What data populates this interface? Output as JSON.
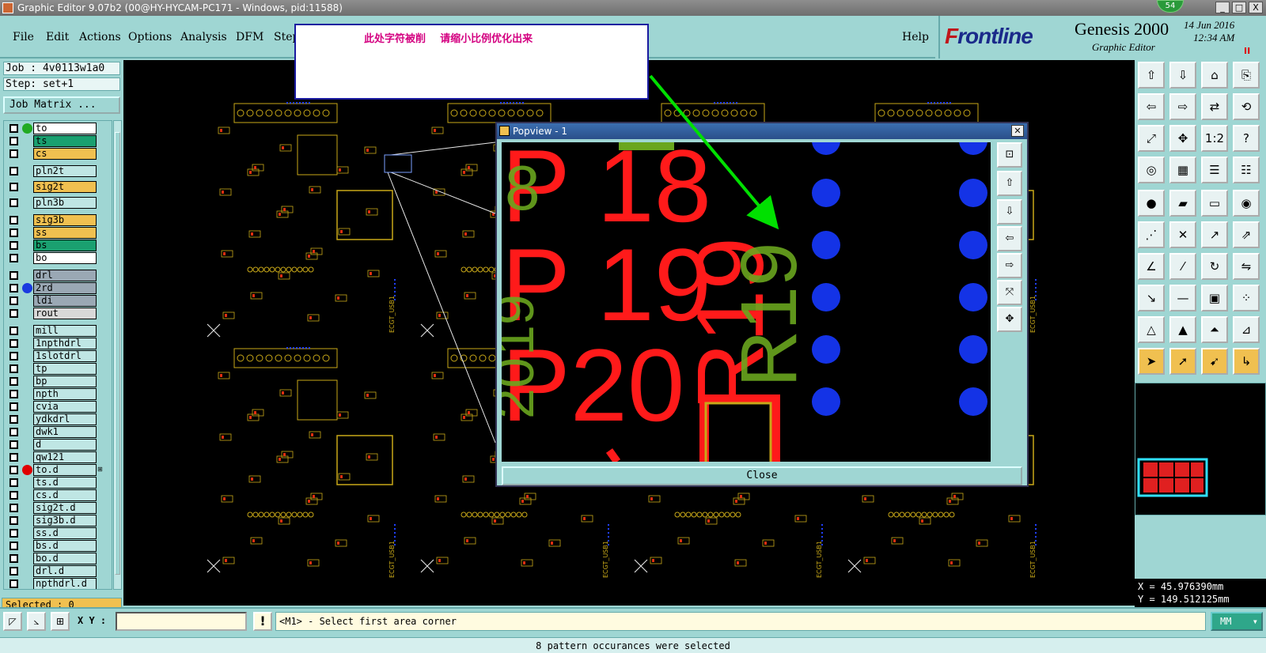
{
  "window": {
    "title": "Graphic Editor 9.07b2 (00@HY-HYCAM-PC171 - Windows, pid:11588)",
    "badge": "54",
    "minimize": "_",
    "maximize": "□",
    "close": "X"
  },
  "menu": {
    "items": [
      "File",
      "Edit",
      "Actions",
      "Options",
      "Analysis",
      "DFM",
      "Step"
    ],
    "help": "Help"
  },
  "brand": {
    "logo_f": "F",
    "logo_rest": "rontline",
    "product": "Genesis 2000",
    "subtitle": "Graphic Editor",
    "date": "14 Jun 2016",
    "time": "12:34 AM",
    "flag": "II"
  },
  "annotation": {
    "text": "此处字符被削    请缩小比例优化出来",
    "arrow_color": "#00e000"
  },
  "left_panel": {
    "job": "Job : 4v0113w1a0",
    "step": "Step: set+1",
    "job_matrix": "Job Matrix ...",
    "selected": "Selected : 0"
  },
  "layers": [
    {
      "name": "to",
      "color": "#ffffff",
      "dot": "#22aa22"
    },
    {
      "name": "ts",
      "color": "#1aa070",
      "dot": ""
    },
    {
      "name": "cs",
      "color": "#f0c050",
      "dot": ""
    },
    {
      "name": "pln2t",
      "color": "#bfe6e4",
      "dot": ""
    },
    {
      "name": "sig2t",
      "color": "#f0c050",
      "dot": ""
    },
    {
      "name": "pln3b",
      "color": "#bfe6e4",
      "dot": ""
    },
    {
      "name": "sig3b",
      "color": "#f0c050",
      "dot": ""
    },
    {
      "name": "ss",
      "color": "#f0c050",
      "dot": ""
    },
    {
      "name": "bs",
      "color": "#1aa070",
      "dot": ""
    },
    {
      "name": "bo",
      "color": "#ffffff",
      "dot": ""
    },
    {
      "name": "drl",
      "color": "#9aa8b4",
      "dot": ""
    },
    {
      "name": "2rd",
      "color": "#9aa8b4",
      "dot": "#1a3ae0"
    },
    {
      "name": "ldi",
      "color": "#9aa8b4",
      "dot": ""
    },
    {
      "name": "rout",
      "color": "#d8d8d8",
      "dot": ""
    },
    {
      "name": "mill",
      "color": "#bfe6e4",
      "dot": ""
    },
    {
      "name": "1npthdrl",
      "color": "#bfe6e4",
      "dot": ""
    },
    {
      "name": "1slotdrl",
      "color": "#bfe6e4",
      "dot": ""
    },
    {
      "name": "tp",
      "color": "#bfe6e4",
      "dot": ""
    },
    {
      "name": "bp",
      "color": "#bfe6e4",
      "dot": ""
    },
    {
      "name": "npth",
      "color": "#bfe6e4",
      "dot": ""
    },
    {
      "name": "cvia",
      "color": "#bfe6e4",
      "dot": ""
    },
    {
      "name": "ydkdrl",
      "color": "#bfe6e4",
      "dot": ""
    },
    {
      "name": "dwk1",
      "color": "#bfe6e4",
      "dot": ""
    },
    {
      "name": "d",
      "color": "#bfe6e4",
      "dot": ""
    },
    {
      "name": "qw121",
      "color": "#bfe6e4",
      "dot": ""
    },
    {
      "name": "to.d",
      "color": "#bfe6e4",
      "dot": "#e00000",
      "tag": "⊞"
    },
    {
      "name": "ts.d",
      "color": "#bfe6e4",
      "dot": ""
    },
    {
      "name": "cs.d",
      "color": "#bfe6e4",
      "dot": ""
    },
    {
      "name": "sig2t.d",
      "color": "#bfe6e4",
      "dot": ""
    },
    {
      "name": "sig3b.d",
      "color": "#bfe6e4",
      "dot": ""
    },
    {
      "name": "ss.d",
      "color": "#bfe6e4",
      "dot": ""
    },
    {
      "name": "bs.d",
      "color": "#bfe6e4",
      "dot": ""
    },
    {
      "name": "bo.d",
      "color": "#bfe6e4",
      "dot": ""
    },
    {
      "name": "drl.d",
      "color": "#bfe6e4",
      "dot": ""
    },
    {
      "name": "npthdrl.d",
      "color": "#bfe6e4",
      "dot": ""
    }
  ],
  "popview": {
    "title": "Popview - 1",
    "close_label": "Close",
    "zoom_text": {
      "line1": "P 18",
      "line2": "P 19",
      "line3": "P20",
      "rotated_red": "R19",
      "rotated_green": "R19",
      "green_left_1": "8",
      "green_left_2": "19",
      "green_left_3": "20"
    },
    "colors": {
      "red": "#ff1a1a",
      "green": "#6aa61e",
      "blue": "#1433e6"
    }
  },
  "canvas": {
    "board_labels": [
      "ECGT_USB1",
      "ECGT_USB1",
      "ECGT_USB1",
      "ECGT_USB1",
      "ECGT_USB1",
      "ECGT_USB1"
    ],
    "silk_color": "#c8a818",
    "pad_color": "#e03010",
    "via_color": "#2040ff"
  },
  "coords": {
    "x": "X = 45.976390mm",
    "y": "Y = 149.512125mm"
  },
  "bottom": {
    "xy_label": "X Y :",
    "xy_value": "",
    "excl": "!",
    "prompt": "<M1> - Select first area corner",
    "units": "MM",
    "status": "8 pattern occurances were selected"
  }
}
